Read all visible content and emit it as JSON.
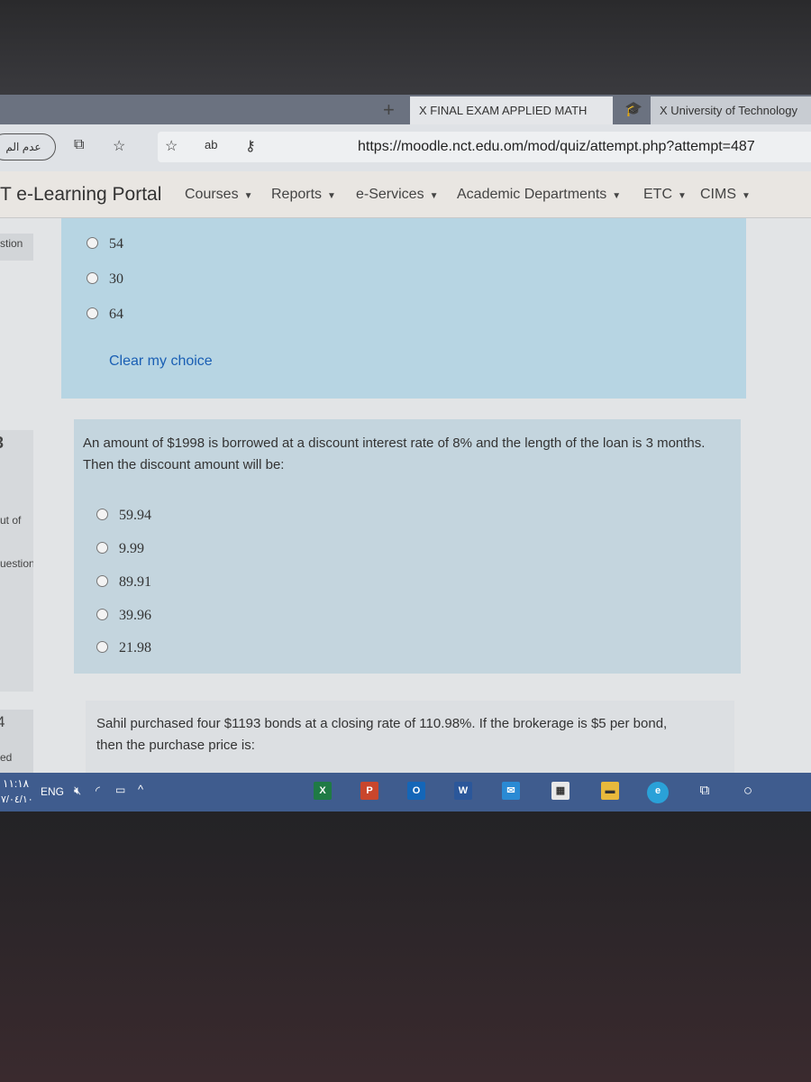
{
  "browser": {
    "tabs": [
      {
        "label": "FINAL EXAM APPLIED MATH",
        "close": "X"
      },
      {
        "label": "University of Technology",
        "close": "X"
      }
    ],
    "new_tab": "+",
    "url": "https://moodle.nct.edu.om/mod/quiz/attempt.php?attempt=487",
    "profile_button": "عدم الم",
    "toolbar_icons": [
      "collections-icon",
      "favorites-icon",
      "add-favorite-icon",
      "read-aloud-icon",
      "key-icon"
    ],
    "read_aloud_label": "ab"
  },
  "nav": {
    "brand": "T e-Learning Portal",
    "menus": [
      "Courses",
      "Reports",
      "e-Services",
      "Academic Departments",
      "ETC",
      "CIMS"
    ]
  },
  "sidebar": {
    "q2_label": "stion",
    "q3_number": "3",
    "q3_out_of": "ut of",
    "q3_question": "uestion",
    "q4_number": "4",
    "q4_status": "ed"
  },
  "q2": {
    "options": [
      "54",
      "30",
      "64"
    ],
    "clear": "Clear my choice"
  },
  "q3": {
    "text": "An amount of $1998 is borrowed at a discount interest rate of 8% and the length of the loan is 3 months. Then the discount amount will be:",
    "options": [
      "59.94",
      "9.99",
      "89.91",
      "39.96",
      "21.98"
    ]
  },
  "q4": {
    "text": "Sahil purchased four $1193 bonds at a closing rate of 110.98%. If the brokerage is $5 per bond, then the purchase price is:"
  },
  "taskbar": {
    "time": "١١:١٨",
    "date": "٧/٠٤/١٠",
    "lang": "ENG",
    "apps": [
      "excel",
      "powerpoint",
      "outlook",
      "word",
      "mail",
      "store",
      "file-explorer",
      "edge",
      "task-view",
      "cortana"
    ]
  }
}
